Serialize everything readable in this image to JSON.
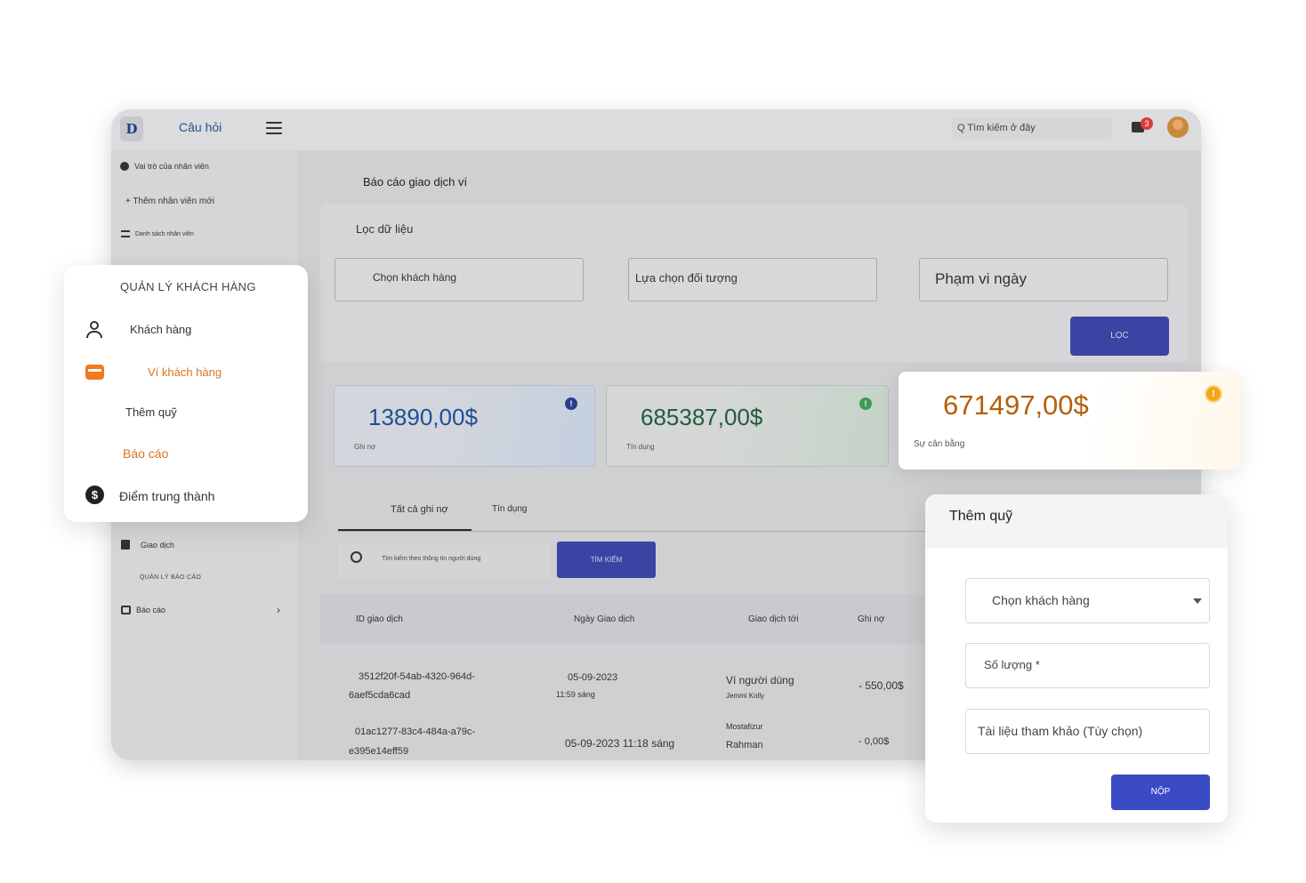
{
  "app": {
    "title": "Câu hỏi",
    "logo": "D",
    "search_placeholder": "Q Tìm kiếm ở đây",
    "notification_count": "3"
  },
  "sidebar": {
    "items": [
      {
        "label": "Vai trò của nhân viên",
        "icon": "gear-icon"
      },
      {
        "label": "+ Thêm nhân viên mới"
      },
      {
        "label": "Danh sách nhân viên",
        "icon": "list-icon"
      },
      {
        "label": "Giao dịch",
        "icon": "document-icon"
      },
      {
        "label": "QUẢN LÝ BÁO CÁO"
      },
      {
        "label": "Báo cáo",
        "icon": "calendar-icon",
        "chevron": "›"
      }
    ]
  },
  "main": {
    "page_title": "Báo cáo giao dịch ví",
    "filter": {
      "title": "Lọc dữ liệu",
      "fields": [
        "Chọn khách hàng",
        "Lựa chọn đối tượng",
        "Phạm vi ngày"
      ],
      "button": "LỌC"
    },
    "stats": [
      {
        "value": "13890,00$",
        "label": "Ghi nợ",
        "color": "#1e4f9a"
      },
      {
        "value": "685387,00$",
        "label": "Tín dụng",
        "color": "#245b3e"
      }
    ],
    "tabs": [
      "Tất cả ghi nợ",
      "Tín dụng"
    ],
    "table_search_placeholder": "Tìm kiếm theo thông tin người dùng",
    "search_button": "TÌM KIẾM",
    "table": {
      "headers": [
        "ID giao dịch",
        "Ngày Giao dịch",
        "Giao dịch tới",
        "Ghi nợ"
      ],
      "rows": [
        {
          "id_line1": "3512f20f-54ab-4320-964d-",
          "id_line2": "6aef5cda6cad",
          "date_line1": "05-09-2023",
          "date_line2": "11:59 sáng",
          "to_line1": "Ví người dùng",
          "to_line2": "Jemmi Kolly",
          "debit": "- 550,00$"
        },
        {
          "id_line1": "01ac1277-83c4-484a-a79c-",
          "id_line2": "e395e14eff59",
          "date": "05-09-2023 11:18 sáng",
          "to_line1": "Mostafizur",
          "to_line2": "Rahman",
          "debit": "- 0,00$"
        }
      ]
    }
  },
  "customer_menu": {
    "heading": "QUẢN LÝ KHÁCH HÀNG",
    "items": [
      {
        "label": "Khách hàng",
        "icon": "person-icon"
      },
      {
        "label": "Ví khách hàng",
        "icon": "wallet-icon",
        "active": true
      },
      {
        "label": "Thêm quỹ"
      },
      {
        "label": "Báo cáo"
      },
      {
        "label": "Điểm trung thành",
        "icon": "dollar-icon"
      }
    ],
    "accent": "#d8731f"
  },
  "balance_card": {
    "value": "671497,00$",
    "label": "Sự cân bằng",
    "color": "#b45f07"
  },
  "add_fund_modal": {
    "title": "Thêm quỹ",
    "customer_select": "Chọn khách hàng",
    "quantity_placeholder": "Số lượng *",
    "reference_placeholder": "Tài liệu tham khảo (Tùy chọn)",
    "submit": "NỘP",
    "button_color": "#3a4bc4"
  }
}
